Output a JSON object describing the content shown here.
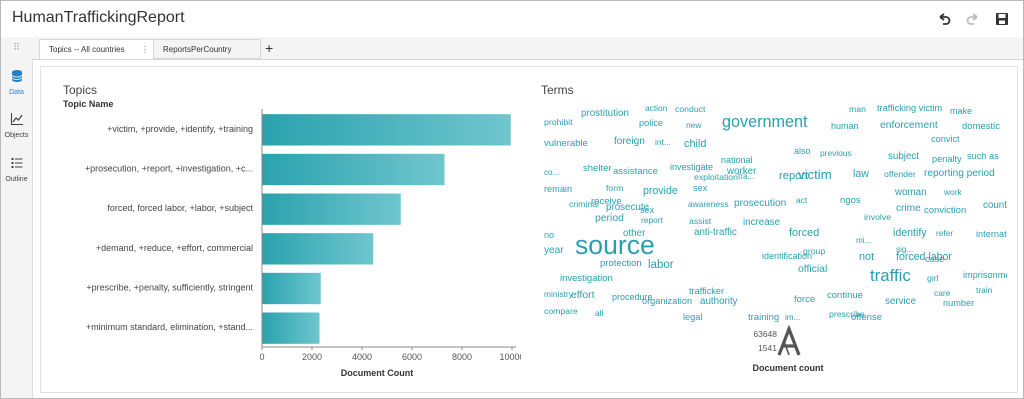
{
  "app": {
    "title": "HumanTraffickingReport"
  },
  "toolbar": {
    "undo": "undo-icon",
    "redo": "redo-icon",
    "save": "save-icon"
  },
  "rail": {
    "grip": "⠿",
    "items": [
      {
        "label": "Data",
        "icon": "database-icon",
        "active": true
      },
      {
        "label": "Objects",
        "icon": "line-chart-icon",
        "active": false
      },
      {
        "label": "Outline",
        "icon": "list-icon",
        "active": false
      }
    ]
  },
  "tabs": [
    {
      "label": "Topics -- All countries",
      "menu": "⋮",
      "active": true
    },
    {
      "label": "ReportsPerCountry",
      "active": false
    }
  ],
  "add_tab": "+",
  "colors": {
    "accent": "#2a9fb1",
    "bar_light": "#6fc6cf",
    "bar_dark": "#2aa2ad",
    "word": "#2a9fb1"
  },
  "topics_panel": {
    "title": "Topics",
    "column_header": "Topic Name",
    "chart_data": {
      "type": "bar",
      "orientation": "horizontal",
      "categories": [
        "+victim, +provide, +identify, +training",
        "+prosecution, +report, +investigation, +c...",
        "forced, forced labor, +labor, +subject",
        "+demand, +reduce, +effort, commercial",
        "+prescribe, +penalty, sufficiently, stringent",
        "+minimum standard, elimination, +stand..."
      ],
      "values": [
        9950,
        7300,
        5550,
        4450,
        2350,
        2300
      ],
      "xlabel": "Document Count",
      "ylabel": "Topic Name",
      "xlim": [
        0,
        10000
      ],
      "ticks": [
        "0",
        "2000",
        "4000",
        "6000",
        "8000",
        "10000"
      ],
      "tick_values": [
        0,
        2000,
        4000,
        6000,
        8000,
        10000
      ],
      "grid": false,
      "legend": "none"
    }
  },
  "terms_panel": {
    "title": "Terms",
    "legend": {
      "title": "Document count",
      "max": "63648",
      "min": "1541",
      "icon": "font-size-icon"
    },
    "words": [
      {
        "t": "prostitution",
        "w": 1
      },
      {
        "t": "action",
        "w": 0.5
      },
      {
        "t": "conduct",
        "w": 0.6
      },
      {
        "t": "man",
        "w": 0.6
      },
      {
        "t": "trafficking victim",
        "w": 0.8
      },
      {
        "t": "make",
        "w": 0.7
      },
      {
        "t": "prohibit",
        "w": 0.6
      },
      {
        "t": "police",
        "w": 0.8
      },
      {
        "t": "new",
        "w": 0.5
      },
      {
        "t": "government",
        "w": 3.3
      },
      {
        "t": "human",
        "w": 0.7
      },
      {
        "t": "enforcement",
        "w": 1.2
      },
      {
        "t": "domestic",
        "w": 0.9
      },
      {
        "t": "vulnerable",
        "w": 0.9
      },
      {
        "t": "foreign",
        "w": 1.1
      },
      {
        "t": "int...",
        "w": 0.5
      },
      {
        "t": "child",
        "w": 1.4
      },
      {
        "t": "convict",
        "w": 0.8
      },
      {
        "t": "national",
        "w": 0.7
      },
      {
        "t": "also",
        "w": 0.7
      },
      {
        "t": "previous",
        "w": 0.5
      },
      {
        "t": "subject",
        "w": 1
      },
      {
        "t": "penalty",
        "w": 0.8
      },
      {
        "t": "such as",
        "w": 0.8
      },
      {
        "t": "co...",
        "w": 0.4
      },
      {
        "t": "shelter",
        "w": 0.9
      },
      {
        "t": "assistance",
        "w": 0.9
      },
      {
        "t": "investigate",
        "w": 0.7
      },
      {
        "t": "worker",
        "w": 1
      },
      {
        "t": "victim",
        "w": 2.2
      },
      {
        "t": "law",
        "w": 1.3
      },
      {
        "t": "offender",
        "w": 0.6
      },
      {
        "t": "reporting period",
        "w": 1.1
      },
      {
        "t": "remain",
        "w": 0.8
      },
      {
        "t": "provide",
        "w": 1.3
      },
      {
        "t": "sex",
        "w": 0.8
      },
      {
        "t": "exploitation",
        "w": 0.6
      },
      {
        "t": "tra...",
        "w": 0.4
      },
      {
        "t": "report",
        "w": 1.5
      },
      {
        "t": "form",
        "w": 0.6
      },
      {
        "t": "woman",
        "w": 1
      },
      {
        "t": "work",
        "w": 0.5
      },
      {
        "t": "criminal",
        "w": 0.6
      },
      {
        "t": "receive",
        "w": 0.9
      },
      {
        "t": "awareness",
        "w": 0.5
      },
      {
        "t": "prosecution",
        "w": 1.1
      },
      {
        "t": "act",
        "w": 0.5
      },
      {
        "t": "ngos",
        "w": 0.9
      },
      {
        "t": "crime",
        "w": 1.1
      },
      {
        "t": "country",
        "w": 1
      },
      {
        "t": "period",
        "w": 1.2
      },
      {
        "t": "prosecute",
        "w": 1
      },
      {
        "t": "sex",
        "w": 0.7
      },
      {
        "t": "report",
        "w": 0.5
      },
      {
        "t": "assist",
        "w": 0.6
      },
      {
        "t": "increase",
        "w": 1
      },
      {
        "t": "involve",
        "w": 0.6
      },
      {
        "t": "conviction",
        "w": 0.9
      },
      {
        "t": "anti-traffic",
        "w": 1
      },
      {
        "t": "forced",
        "w": 1.4
      },
      {
        "t": "identify",
        "w": 1.3
      },
      {
        "t": "refer",
        "w": 0.5
      },
      {
        "t": "international",
        "w": 0.8
      },
      {
        "t": "no",
        "w": 0.7
      },
      {
        "t": "other",
        "w": 1
      },
      {
        "t": "mi...",
        "w": 0.4
      },
      {
        "t": "sig...",
        "w": 0.4
      },
      {
        "t": "year",
        "w": 1.1
      },
      {
        "t": "source",
        "w": 7
      },
      {
        "t": "labor",
        "w": 1.6
      },
      {
        "t": "identification",
        "w": 0.7
      },
      {
        "t": "group",
        "w": 0.6
      },
      {
        "t": "not",
        "w": 1.4
      },
      {
        "t": "forced labor",
        "w": 1.3
      },
      {
        "t": "case",
        "w": 0.8
      },
      {
        "t": "protection",
        "w": 0.9
      },
      {
        "t": "official",
        "w": 1.2
      },
      {
        "t": "girl",
        "w": 0.6
      },
      {
        "t": "imprisonment",
        "w": 0.8
      },
      {
        "t": "investigation",
        "w": 0.9
      },
      {
        "t": "traffic",
        "w": 3.5
      },
      {
        "t": "force",
        "w": 0.9
      },
      {
        "t": "care",
        "w": 0.5
      },
      {
        "t": "train",
        "w": 0.5
      },
      {
        "t": "ministry",
        "w": 0.5
      },
      {
        "t": "effort",
        "w": 1.2
      },
      {
        "t": "procedure",
        "w": 0.7
      },
      {
        "t": "trafficker",
        "w": 0.8
      },
      {
        "t": "continue",
        "w": 0.9
      },
      {
        "t": "organization",
        "w": 0.8
      },
      {
        "t": "authority",
        "w": 1
      },
      {
        "t": "service",
        "w": 1
      },
      {
        "t": "number",
        "w": 0.8
      },
      {
        "t": "compare",
        "w": 0.6
      },
      {
        "t": "all",
        "w": 0.5
      },
      {
        "t": "legal",
        "w": 0.8
      },
      {
        "t": "training",
        "w": 0.9
      },
      {
        "t": "im...",
        "w": 0.4
      },
      {
        "t": "prescribe",
        "w": 0.6
      },
      {
        "t": "offense",
        "w": 0.9
      }
    ]
  }
}
